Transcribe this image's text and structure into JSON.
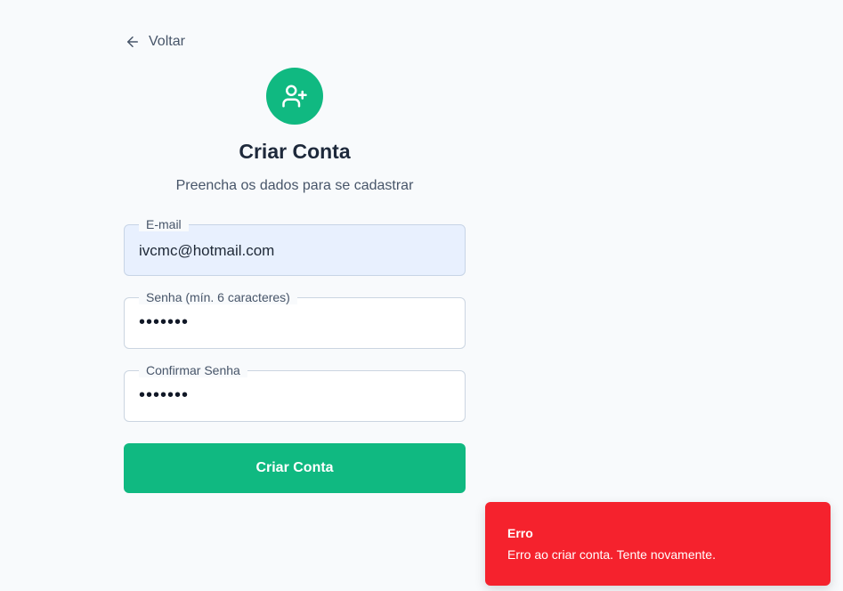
{
  "nav": {
    "back_label": "Voltar"
  },
  "header": {
    "title": "Criar Conta",
    "subtitle": "Preencha os dados para se cadastrar"
  },
  "form": {
    "email": {
      "label": "E-mail",
      "value": "ivcmc@hotmail.com"
    },
    "password": {
      "label": "Senha (mín. 6 caracteres)",
      "value": "•••••••"
    },
    "confirm_password": {
      "label": "Confirmar Senha",
      "value": "•••••••"
    },
    "submit_label": "Criar Conta"
  },
  "toast": {
    "title": "Erro",
    "message": "Erro ao criar conta. Tente novamente.",
    "color": "#f5222d"
  },
  "colors": {
    "accent": "#10b981",
    "background": "#f8fafc"
  },
  "icons": {
    "back": "arrow-left-icon",
    "avatar": "user-plus-icon"
  }
}
